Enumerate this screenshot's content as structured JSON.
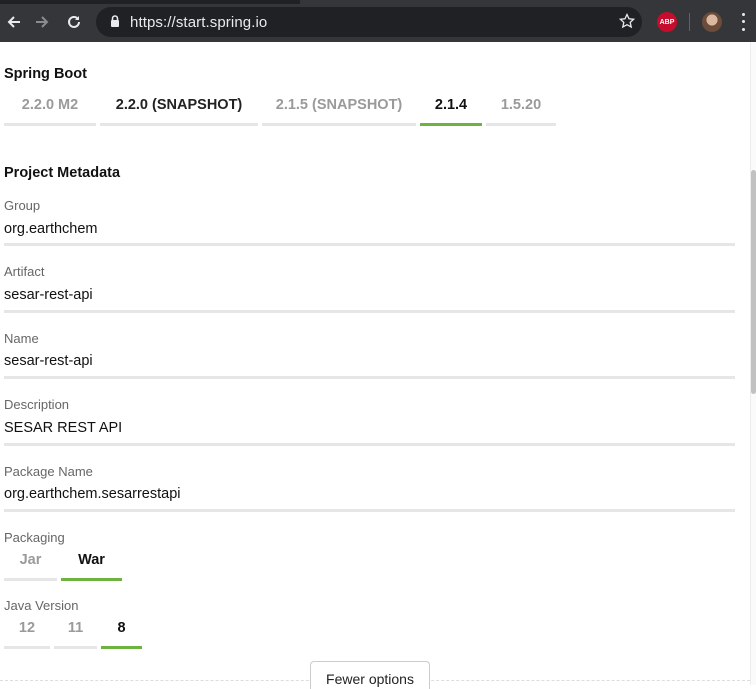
{
  "browser": {
    "url": "https://start.spring.io",
    "extension_label": "ABP"
  },
  "spring_boot": {
    "title": "Spring Boot",
    "versions": [
      {
        "label": "2.2.0 M2",
        "state": "muted"
      },
      {
        "label": "2.2.0 (SNAPSHOT)",
        "state": "normal"
      },
      {
        "label": "2.1.5 (SNAPSHOT)",
        "state": "muted"
      },
      {
        "label": "2.1.4",
        "state": "selected"
      },
      {
        "label": "1.5.20",
        "state": "muted"
      }
    ]
  },
  "metadata": {
    "title": "Project Metadata",
    "fields": [
      {
        "label": "Group",
        "value": "org.earthchem"
      },
      {
        "label": "Artifact",
        "value": "sesar-rest-api"
      },
      {
        "label": "Name",
        "value": "sesar-rest-api"
      },
      {
        "label": "Description",
        "value": "SESAR REST API"
      },
      {
        "label": "Package Name",
        "value": "org.earthchem.sesarrestapi"
      }
    ],
    "packaging": {
      "label": "Packaging",
      "options": [
        {
          "label": "Jar",
          "state": "muted"
        },
        {
          "label": "War",
          "state": "selected"
        }
      ]
    },
    "java_version": {
      "label": "Java Version",
      "options": [
        {
          "label": "12",
          "state": "muted"
        },
        {
          "label": "11",
          "state": "muted"
        },
        {
          "label": "8",
          "state": "selected"
        }
      ]
    }
  },
  "fewer_options_label": "Fewer options",
  "colors": {
    "accent": "#6db33f",
    "browser_chrome": "#35363a"
  }
}
